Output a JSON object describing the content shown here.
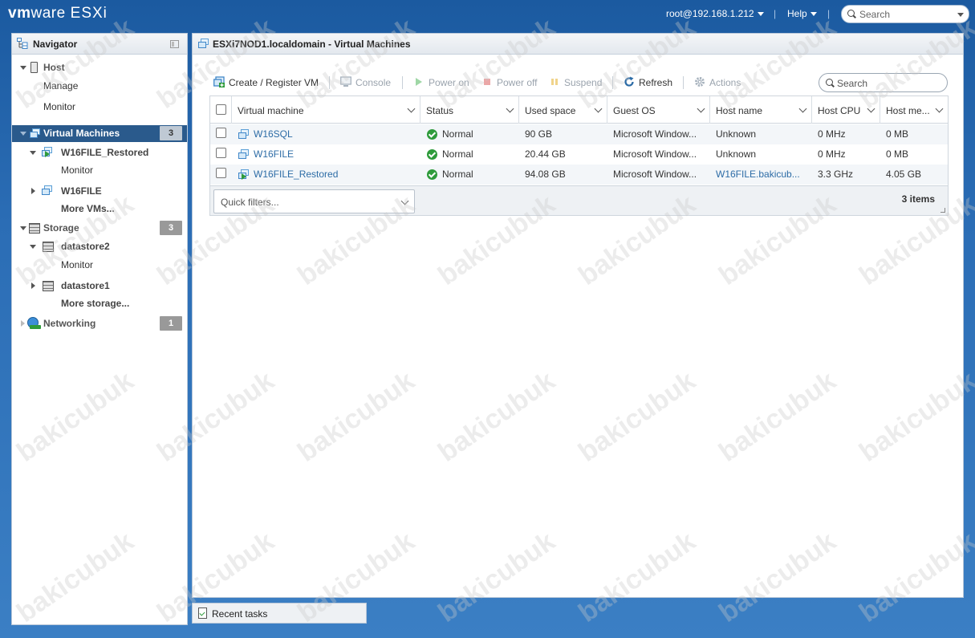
{
  "app": {
    "logo_vm": "vm",
    "logo_ware": "ware",
    "logo_product": "ESXi",
    "user": "root@192.168.1.212",
    "help": "Help",
    "search_placeholder": "Search"
  },
  "navigator": {
    "title": "Navigator",
    "host": {
      "label": "Host",
      "children": [
        "Manage",
        "Monitor"
      ]
    },
    "virtual_machines": {
      "label": "Virtual Machines",
      "count": "3",
      "items": [
        {
          "label": "W16FILE_Restored",
          "child": "Monitor"
        },
        {
          "label": "W16FILE"
        }
      ],
      "more": "More VMs..."
    },
    "storage": {
      "label": "Storage",
      "count": "3",
      "items": [
        {
          "label": "datastore2",
          "child": "Monitor"
        },
        {
          "label": "datastore1"
        }
      ],
      "more": "More storage..."
    },
    "networking": {
      "label": "Networking",
      "count": "1"
    }
  },
  "main": {
    "title": "ESXi7NOD1.localdomain - Virtual Machines",
    "toolbar": {
      "create": "Create / Register VM",
      "console": "Console",
      "power_on": "Power on",
      "power_off": "Power off",
      "suspend": "Suspend",
      "refresh": "Refresh",
      "actions": "Actions"
    },
    "search_placeholder": "Search",
    "columns": [
      "Virtual machine",
      "Status",
      "Used space",
      "Guest OS",
      "Host name",
      "Host CPU",
      "Host me..."
    ],
    "rows": [
      {
        "name": "W16SQL",
        "status": "Normal",
        "used": "90 GB",
        "os": "Microsoft Window...",
        "host": "Unknown",
        "cpu": "0 MHz",
        "mem": "0 MB"
      },
      {
        "name": "W16FILE",
        "status": "Normal",
        "used": "20.44 GB",
        "os": "Microsoft Window...",
        "host": "Unknown",
        "cpu": "0 MHz",
        "mem": "0 MB"
      },
      {
        "name": "W16FILE_Restored",
        "status": "Normal",
        "used": "94.08 GB",
        "os": "Microsoft Window...",
        "host": "W16FILE.bakicub...",
        "cpu": "3.3 GHz",
        "mem": "4.05 GB"
      }
    ],
    "quick_filters": "Quick filters...",
    "items_count": "3 items"
  },
  "recent_tasks": "Recent tasks",
  "watermark": "bakicubuk"
}
